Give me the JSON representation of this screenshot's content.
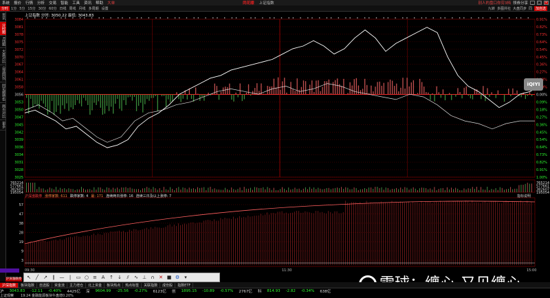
{
  "menu": {
    "items": [
      "系统",
      "报价",
      "行情",
      "分析",
      "交易",
      "智能",
      "工具",
      "资讯",
      "帮助",
      "大单"
    ],
    "logo": "同花顺",
    "window_title": "上证指数",
    "right_text": "别人的盘口你穷3档",
    "right_link": "领券分享",
    "right_items": [
      "九转",
      "多图共社",
      "大盘同步",
      "同",
      "加自选",
      "□"
    ]
  },
  "toolbar": {
    "items": [
      "分时",
      "1分",
      "5分",
      "15分",
      "30分",
      "60分",
      "日线",
      "周线",
      "月线",
      "多周期",
      "设置"
    ],
    "right": [
      "九转",
      "多图共社",
      "大盘同步",
      "同",
      "加自选"
    ]
  },
  "sidebar": {
    "items": [
      "资讯",
      "分时图",
      "K线图",
      "大盘对比",
      "自选同列",
      "同花顺特色",
      "两市对比",
      "更多"
    ]
  },
  "quote": {
    "name": "上证指数",
    "prefix": "分时:",
    "price": "3050.22",
    "avg_label": "最低:",
    "avg": "3043.83"
  },
  "price_axis": {
    "left": [
      "3084",
      "3081",
      "3078",
      "3075",
      "3072",
      "3070",
      "3067",
      "3064",
      "3061",
      "3058",
      "3056",
      "3053",
      "3050",
      "3047",
      "3045",
      "3042",
      "3039",
      "3036",
      "3034",
      "3031",
      "3028",
      "3025"
    ],
    "right": [
      "0.91%",
      "0.82%",
      "0.73%",
      "0.64%",
      "0.54%",
      "0.45%",
      "0.36%",
      "0.27%",
      "0.18%",
      "0.09%",
      "0.00%",
      "0.09%",
      "0.18%",
      "0.27%",
      "0.36%",
      "0.45%",
      "0.54%",
      "0.64%",
      "0.73%",
      "0.82%",
      "0.91%",
      "1.00%"
    ]
  },
  "volume_axis": {
    "left": [
      "765214",
      "577661",
      "382607",
      "195054"
    ],
    "right": [
      "765214",
      "577661",
      "382607",
      "195054"
    ]
  },
  "indicator": {
    "title": "沪深涨跌停",
    "t2": "涨停家数: 611",
    "t3": "跌停家数: 4",
    "t4": "最: 171",
    "t5": "连续两日涨停: 16",
    "t6": "连续三日及以上涨停: 7",
    "right": "指标说明",
    "axis": [
      "57",
      "47",
      "38",
      "28",
      "19",
      "9",
      "3"
    ]
  },
  "time_labels": [
    "09:30",
    "11:30",
    "15:00"
  ],
  "bottom_tabs": [
    "沪深指数",
    "板块指数",
    "自选股",
    "资金流",
    "主力增仓",
    "北上资金",
    "板块热点",
    "热点标签",
    "关联指数",
    "成份股",
    "指数ETF"
  ],
  "status": {
    "sh_label": "沪",
    "sh_price": "3043.83",
    "sh_change": "-12.11",
    "sh_pct": "-0.40%",
    "sh_amount": "4425亿",
    "sz_label": "深",
    "sz_price": "9604.99",
    "sz_change": "-25.56",
    "sz_pct": "-0.27%",
    "sz_amount": "6123亿",
    "cy_label": "创",
    "cy_price": "1895.15",
    "cy_change": "-10.89",
    "cy_pct": "-0.57%",
    "cy_amount": "2767亿",
    "kc_label": "科",
    "kc_price": "814.93",
    "kc_change": "-2.82",
    "kc_pct": "-0.34%",
    "kc_amount": "638亿"
  },
  "news": {
    "n1": "上证观察",
    "n2": "19:24 金融能源板块午盘增0.20%"
  },
  "overlay": {
    "iqiyi": "iQIYI",
    "watermark": "雪球：缠心-又见缠心",
    "purple_label": "沪深涨跌停"
  },
  "colors": {
    "up": "#ff3030",
    "down": "#30ff30",
    "grid": "#8b0000",
    "line1": "#ffffff",
    "accent": "#cc0000"
  }
}
